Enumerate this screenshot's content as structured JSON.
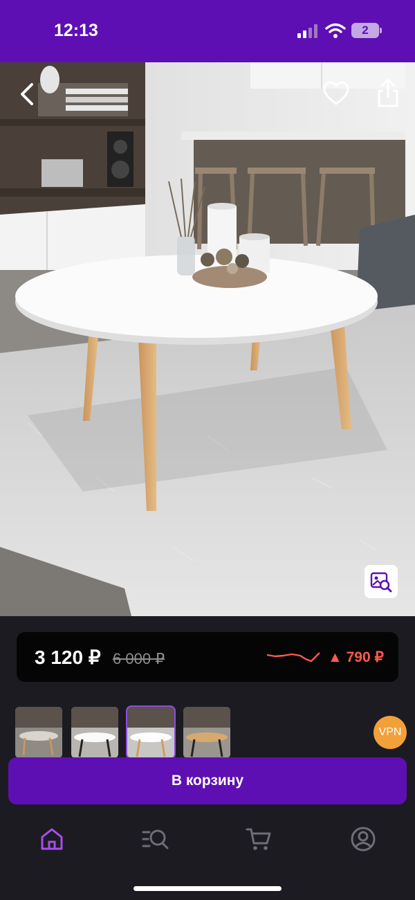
{
  "status": {
    "time": "12:13",
    "battery": "2",
    "icons": [
      "cellular-signal-icon",
      "wifi-icon",
      "battery-icon"
    ]
  },
  "header": {
    "icons": [
      "back-icon",
      "heart-icon",
      "share-icon"
    ]
  },
  "photo": {
    "icons": [
      "visual-search-icon"
    ]
  },
  "price": {
    "current": "3 120 ₽",
    "old": "6 000 ₽",
    "change": "▲ 790 ₽",
    "change_color": "#ff5a4e"
  },
  "thumbnails": {
    "count_selected_index": 2,
    "items": [
      "table-grey-legs",
      "table-white-dark-legs",
      "table-white-wood-legs",
      "table-wood-top"
    ]
  },
  "vpn_badge": "VPN",
  "cart_button": "В корзину",
  "tabbar": {
    "items": [
      "home-icon",
      "catalog-search-icon",
      "cart-icon",
      "profile-icon"
    ],
    "active_index": 0,
    "active_color": "#a74ef0"
  },
  "colors": {
    "brand": "#5e0fb3",
    "background": "#1c1b21"
  }
}
